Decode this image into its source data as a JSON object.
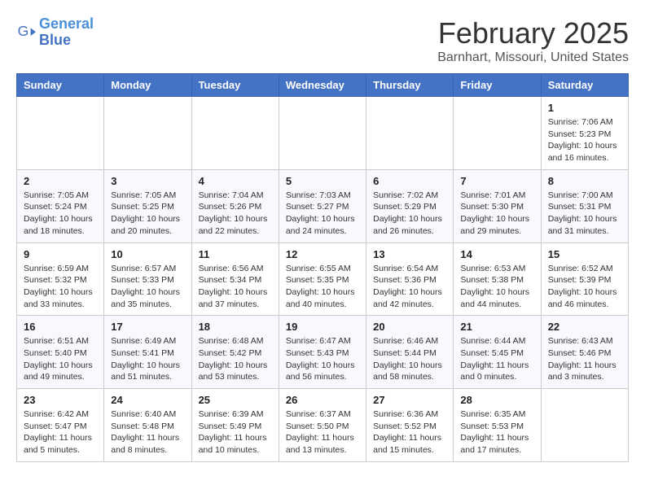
{
  "header": {
    "logo_line1": "General",
    "logo_line2": "Blue",
    "month": "February 2025",
    "location": "Barnhart, Missouri, United States"
  },
  "weekdays": [
    "Sunday",
    "Monday",
    "Tuesday",
    "Wednesday",
    "Thursday",
    "Friday",
    "Saturday"
  ],
  "weeks": [
    [
      {
        "day": "",
        "info": ""
      },
      {
        "day": "",
        "info": ""
      },
      {
        "day": "",
        "info": ""
      },
      {
        "day": "",
        "info": ""
      },
      {
        "day": "",
        "info": ""
      },
      {
        "day": "",
        "info": ""
      },
      {
        "day": "1",
        "info": "Sunrise: 7:06 AM\nSunset: 5:23 PM\nDaylight: 10 hours\nand 16 minutes."
      }
    ],
    [
      {
        "day": "2",
        "info": "Sunrise: 7:05 AM\nSunset: 5:24 PM\nDaylight: 10 hours\nand 18 minutes."
      },
      {
        "day": "3",
        "info": "Sunrise: 7:05 AM\nSunset: 5:25 PM\nDaylight: 10 hours\nand 20 minutes."
      },
      {
        "day": "4",
        "info": "Sunrise: 7:04 AM\nSunset: 5:26 PM\nDaylight: 10 hours\nand 22 minutes."
      },
      {
        "day": "5",
        "info": "Sunrise: 7:03 AM\nSunset: 5:27 PM\nDaylight: 10 hours\nand 24 minutes."
      },
      {
        "day": "6",
        "info": "Sunrise: 7:02 AM\nSunset: 5:29 PM\nDaylight: 10 hours\nand 26 minutes."
      },
      {
        "day": "7",
        "info": "Sunrise: 7:01 AM\nSunset: 5:30 PM\nDaylight: 10 hours\nand 29 minutes."
      },
      {
        "day": "8",
        "info": "Sunrise: 7:00 AM\nSunset: 5:31 PM\nDaylight: 10 hours\nand 31 minutes."
      }
    ],
    [
      {
        "day": "9",
        "info": "Sunrise: 6:59 AM\nSunset: 5:32 PM\nDaylight: 10 hours\nand 33 minutes."
      },
      {
        "day": "10",
        "info": "Sunrise: 6:57 AM\nSunset: 5:33 PM\nDaylight: 10 hours\nand 35 minutes."
      },
      {
        "day": "11",
        "info": "Sunrise: 6:56 AM\nSunset: 5:34 PM\nDaylight: 10 hours\nand 37 minutes."
      },
      {
        "day": "12",
        "info": "Sunrise: 6:55 AM\nSunset: 5:35 PM\nDaylight: 10 hours\nand 40 minutes."
      },
      {
        "day": "13",
        "info": "Sunrise: 6:54 AM\nSunset: 5:36 PM\nDaylight: 10 hours\nand 42 minutes."
      },
      {
        "day": "14",
        "info": "Sunrise: 6:53 AM\nSunset: 5:38 PM\nDaylight: 10 hours\nand 44 minutes."
      },
      {
        "day": "15",
        "info": "Sunrise: 6:52 AM\nSunset: 5:39 PM\nDaylight: 10 hours\nand 46 minutes."
      }
    ],
    [
      {
        "day": "16",
        "info": "Sunrise: 6:51 AM\nSunset: 5:40 PM\nDaylight: 10 hours\nand 49 minutes."
      },
      {
        "day": "17",
        "info": "Sunrise: 6:49 AM\nSunset: 5:41 PM\nDaylight: 10 hours\nand 51 minutes."
      },
      {
        "day": "18",
        "info": "Sunrise: 6:48 AM\nSunset: 5:42 PM\nDaylight: 10 hours\nand 53 minutes."
      },
      {
        "day": "19",
        "info": "Sunrise: 6:47 AM\nSunset: 5:43 PM\nDaylight: 10 hours\nand 56 minutes."
      },
      {
        "day": "20",
        "info": "Sunrise: 6:46 AM\nSunset: 5:44 PM\nDaylight: 10 hours\nand 58 minutes."
      },
      {
        "day": "21",
        "info": "Sunrise: 6:44 AM\nSunset: 5:45 PM\nDaylight: 11 hours\nand 0 minutes."
      },
      {
        "day": "22",
        "info": "Sunrise: 6:43 AM\nSunset: 5:46 PM\nDaylight: 11 hours\nand 3 minutes."
      }
    ],
    [
      {
        "day": "23",
        "info": "Sunrise: 6:42 AM\nSunset: 5:47 PM\nDaylight: 11 hours\nand 5 minutes."
      },
      {
        "day": "24",
        "info": "Sunrise: 6:40 AM\nSunset: 5:48 PM\nDaylight: 11 hours\nand 8 minutes."
      },
      {
        "day": "25",
        "info": "Sunrise: 6:39 AM\nSunset: 5:49 PM\nDaylight: 11 hours\nand 10 minutes."
      },
      {
        "day": "26",
        "info": "Sunrise: 6:37 AM\nSunset: 5:50 PM\nDaylight: 11 hours\nand 13 minutes."
      },
      {
        "day": "27",
        "info": "Sunrise: 6:36 AM\nSunset: 5:52 PM\nDaylight: 11 hours\nand 15 minutes."
      },
      {
        "day": "28",
        "info": "Sunrise: 6:35 AM\nSunset: 5:53 PM\nDaylight: 11 hours\nand 17 minutes."
      },
      {
        "day": "",
        "info": ""
      }
    ]
  ]
}
